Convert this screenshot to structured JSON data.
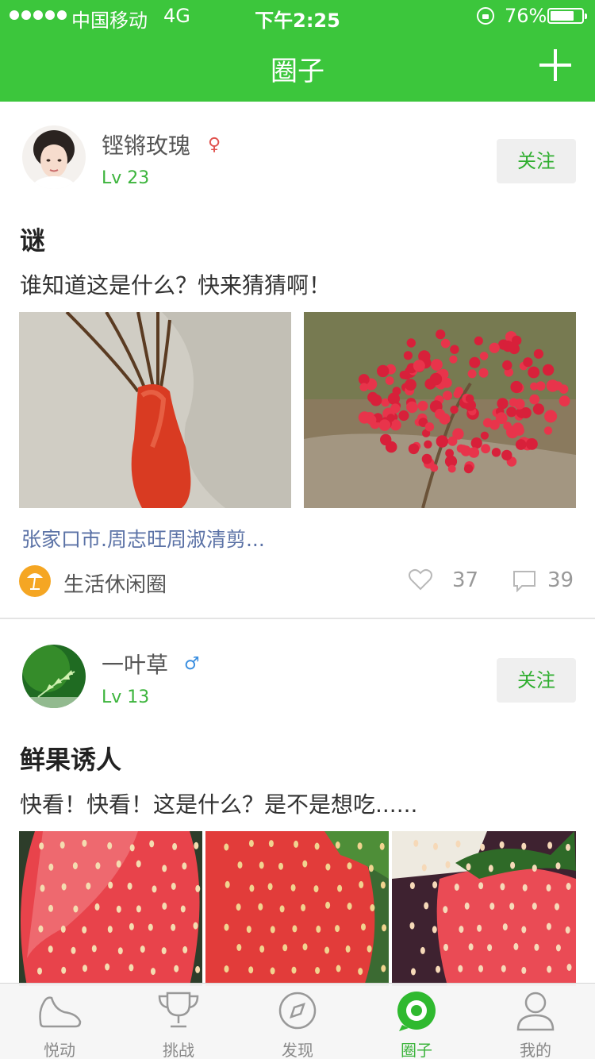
{
  "status_bar": {
    "carrier": "中国移动",
    "network": "4G",
    "time": "下午2:25",
    "battery": "76%",
    "battery_level": 0.76
  },
  "nav": {
    "title": "圈子"
  },
  "posts": [
    {
      "username": "铿锵玫瑰",
      "gender_symbol": "♀",
      "gender_color": "#e0524e",
      "level": "Lv 23",
      "follow": "关注",
      "title": "谜",
      "body": "谁知道这是什么？快来猜猜啊！",
      "location": "张家口市.周志旺周淑清剪...",
      "circle": "生活休闲圈",
      "likes": "37",
      "comments": "39"
    },
    {
      "username": "一叶草",
      "gender_symbol": "♂",
      "gender_color": "#3b8fe0",
      "level": "Lv 13",
      "follow": "关注",
      "title": "鲜果诱人",
      "body": "快看！快看！这是什么？是不是想吃......"
    }
  ],
  "tabs": [
    {
      "label": "悦动",
      "icon": "shoe-icon"
    },
    {
      "label": "挑战",
      "icon": "trophy-icon"
    },
    {
      "label": "发现",
      "icon": "compass-icon"
    },
    {
      "label": "圈子",
      "icon": "circle-icon"
    },
    {
      "label": "我的",
      "icon": "person-icon"
    }
  ],
  "colors": {
    "brand_green": "#3cc63c",
    "link_blue": "#5b72a6"
  }
}
